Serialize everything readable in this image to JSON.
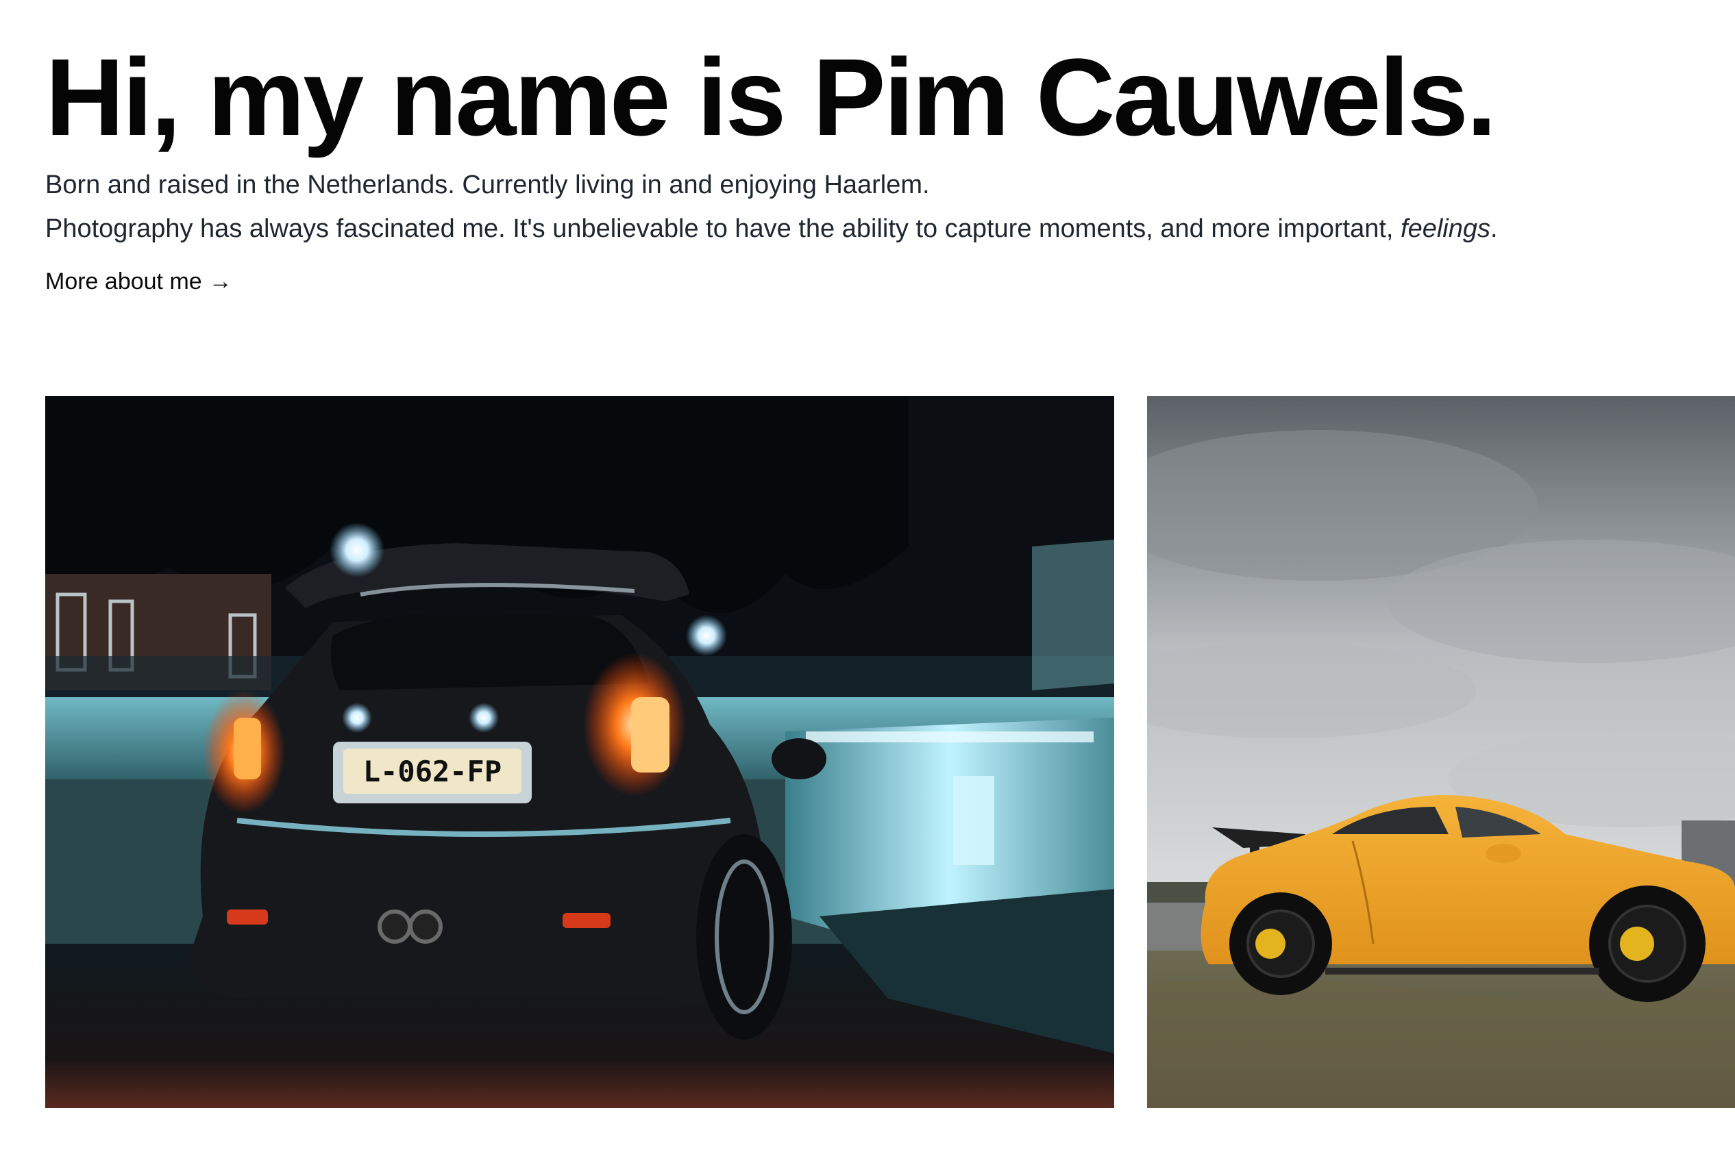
{
  "hero": {
    "title": "Hi, my name is Pim Cauwels.",
    "bio_line_1": "Born and raised in the Netherlands. Currently living in and enjoying Haarlem.",
    "bio_line_2_main": "Photography has always fascinated me. It's unbelievable to have the ability to capture moments, and more important, ",
    "bio_line_2_em": "feelings",
    "bio_line_2_end": ".",
    "more_link_label": "More about me",
    "more_link_arrow": "→"
  },
  "gallery": {
    "photos": [
      {
        "subject": "dark car rear at night",
        "plate": "L-062-FP"
      },
      {
        "subject": "yellow sports car on grass"
      }
    ]
  },
  "colors": {
    "text": "#050505",
    "body_text": "#1f2630",
    "background": "#ffffff"
  }
}
